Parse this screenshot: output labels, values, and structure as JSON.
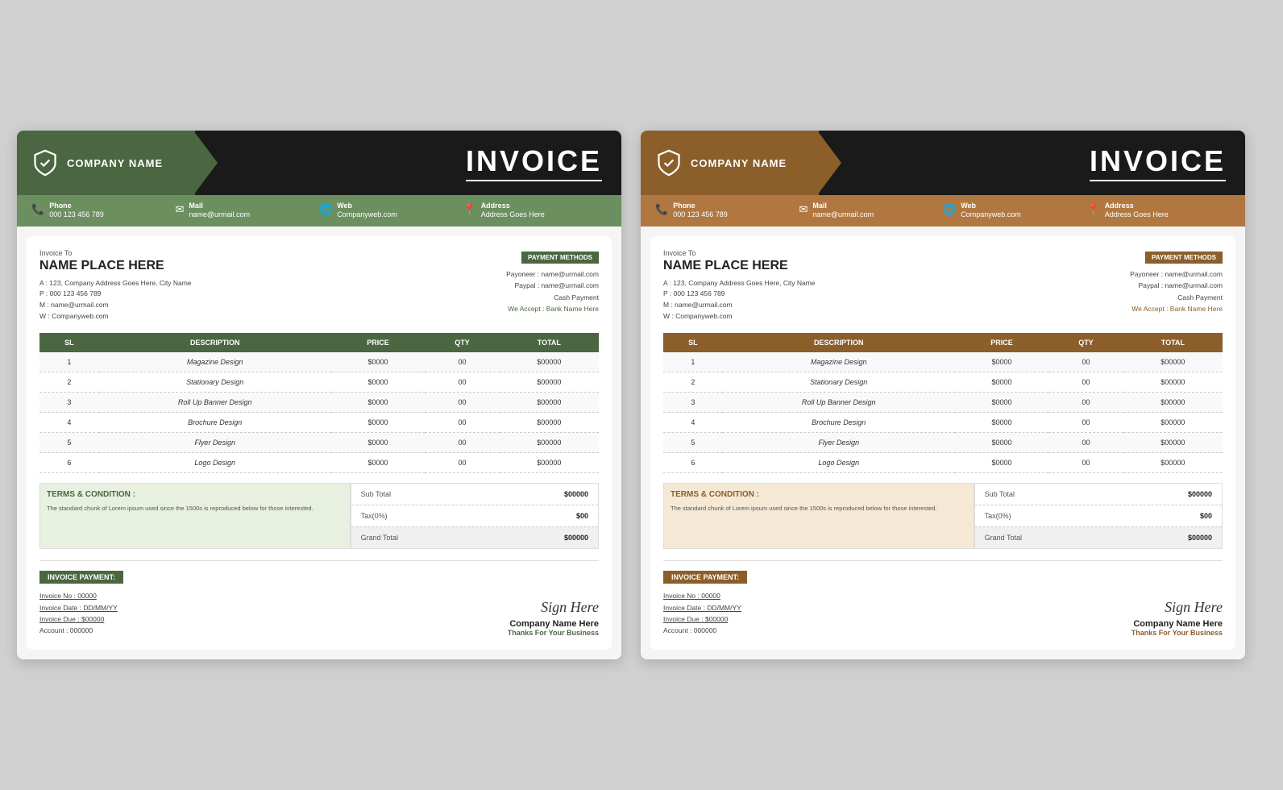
{
  "invoices": [
    {
      "id": "green",
      "theme": "green",
      "accent": "#4a6741",
      "accent_light": "#6b8f5e",
      "accent_pale": "#e8f0e0",
      "header": {
        "company_name": "COMPANY NAME",
        "title": "INVOICE"
      },
      "contact": {
        "phone_label": "Phone",
        "phone": "000 123 456 789",
        "mail_label": "Mail",
        "mail": "name@urmail.com",
        "web_label": "Web",
        "web": "Companyweb.com",
        "address_label": "Address",
        "address": "Address Goes Here"
      },
      "invoice_to": {
        "label": "Invoice To",
        "name": "NAME PLACE HERE",
        "address": "A : 123, Company Address Goes Here, City Name",
        "phone": "P : 000 123 456 789",
        "mail": "M : name@urmail.com",
        "web": "W : Companyweb.com"
      },
      "payment_methods": {
        "badge": "PAYMENT METHODS",
        "payoneer": "Payoneer : name@urmail.com",
        "paypal": "Paypal : name@urmail.com",
        "cash": "Cash Payment",
        "bank": "We Accept : Bank Name Here"
      },
      "table": {
        "headers": [
          "SL",
          "DESCRIPTION",
          "PRICE",
          "QTY",
          "TOTAL"
        ],
        "rows": [
          {
            "sl": "1",
            "desc": "Magazine Design",
            "price": "$0000",
            "qty": "00",
            "total": "$00000"
          },
          {
            "sl": "2",
            "desc": "Stationary Design",
            "price": "$0000",
            "qty": "00",
            "total": "$00000"
          },
          {
            "sl": "3",
            "desc": "Roll Up Banner Design",
            "price": "$0000",
            "qty": "00",
            "total": "$00000"
          },
          {
            "sl": "4",
            "desc": "Brochure Design",
            "price": "$0000",
            "qty": "00",
            "total": "$00000"
          },
          {
            "sl": "5",
            "desc": "Flyer Design",
            "price": "$0000",
            "qty": "00",
            "total": "$00000"
          },
          {
            "sl": "6",
            "desc": "Logo Design",
            "price": "$0000",
            "qty": "00",
            "total": "$00000"
          }
        ]
      },
      "terms": {
        "title": "TERMS & CONDITION :",
        "text": "The standard chunk of Lorem ipsum used since the 1500s is reproduced below for those interested."
      },
      "totals": {
        "sub_total_label": "Sub Total",
        "sub_total": "$00000",
        "tax_label": "Tax(0%)",
        "tax": "$00",
        "grand_total_label": "Grand Total",
        "grand_total": "$00000"
      },
      "payment": {
        "badge": "INVOICE PAYMENT:",
        "invoice_no_label": "Invoice No : 00000",
        "invoice_date_label": "Invoice Date : DD/MM/YY",
        "invoice_due_label": "Invoice Due : $00000",
        "account_label": "Account : 000000"
      },
      "footer": {
        "sign": "Sign Here",
        "company": "Company Name Here",
        "thanks": "Thanks For Your Business"
      }
    },
    {
      "id": "brown",
      "theme": "brown",
      "accent": "#8b5e2a",
      "accent_light": "#b07840",
      "accent_pale": "#f5e8d5",
      "header": {
        "company_name": "COMPANY NAME",
        "title": "INVOICE"
      },
      "contact": {
        "phone_label": "Phone",
        "phone": "000 123 456 789",
        "mail_label": "Mail",
        "mail": "name@urmail.com",
        "web_label": "Web",
        "web": "Companyweb.com",
        "address_label": "Address",
        "address": "Address Goes Here"
      },
      "invoice_to": {
        "label": "Invoice To",
        "name": "NAME PLACE HERE",
        "address": "A : 123, Company Address Goes Here, City Name",
        "phone": "P : 000 123 456 789",
        "mail": "M : name@urmail.com",
        "web": "W : Companyweb.com"
      },
      "payment_methods": {
        "badge": "PAYMENT METHODS",
        "payoneer": "Payoneer : name@urmail.com",
        "paypal": "Paypal : name@urmail.com",
        "cash": "Cash Payment",
        "bank": "We Accept : Bank Name Here"
      },
      "table": {
        "headers": [
          "SL",
          "DESCRIPTION",
          "PRICE",
          "QTY",
          "TOTAL"
        ],
        "rows": [
          {
            "sl": "1",
            "desc": "Magazine Design",
            "price": "$0000",
            "qty": "00",
            "total": "$00000"
          },
          {
            "sl": "2",
            "desc": "Stationary Design",
            "price": "$0000",
            "qty": "00",
            "total": "$00000"
          },
          {
            "sl": "3",
            "desc": "Roll Up Banner Design",
            "price": "$0000",
            "qty": "00",
            "total": "$00000"
          },
          {
            "sl": "4",
            "desc": "Brochure Design",
            "price": "$0000",
            "qty": "00",
            "total": "$00000"
          },
          {
            "sl": "5",
            "desc": "Flyer Design",
            "price": "$0000",
            "qty": "00",
            "total": "$00000"
          },
          {
            "sl": "6",
            "desc": "Logo Design",
            "price": "$0000",
            "qty": "00",
            "total": "$00000"
          }
        ]
      },
      "terms": {
        "title": "TERMS & CONDITION :",
        "text": "The standard chunk of Lorem ipsum used since the 1500s is reproduced below for those interested."
      },
      "totals": {
        "sub_total_label": "Sub Total",
        "sub_total": "$00000",
        "tax_label": "Tax(0%)",
        "tax": "$00",
        "grand_total_label": "Grand Total",
        "grand_total": "$00000"
      },
      "payment": {
        "badge": "INVOICE PAYMENT:",
        "invoice_no_label": "Invoice No : 00000",
        "invoice_date_label": "Invoice Date : DD/MM/YY",
        "invoice_due_label": "Invoice Due : $00000",
        "account_label": "Account : 000000"
      },
      "footer": {
        "sign": "Sign Here",
        "company": "Company Name Here",
        "thanks": "Thanks For Your Business"
      }
    }
  ]
}
